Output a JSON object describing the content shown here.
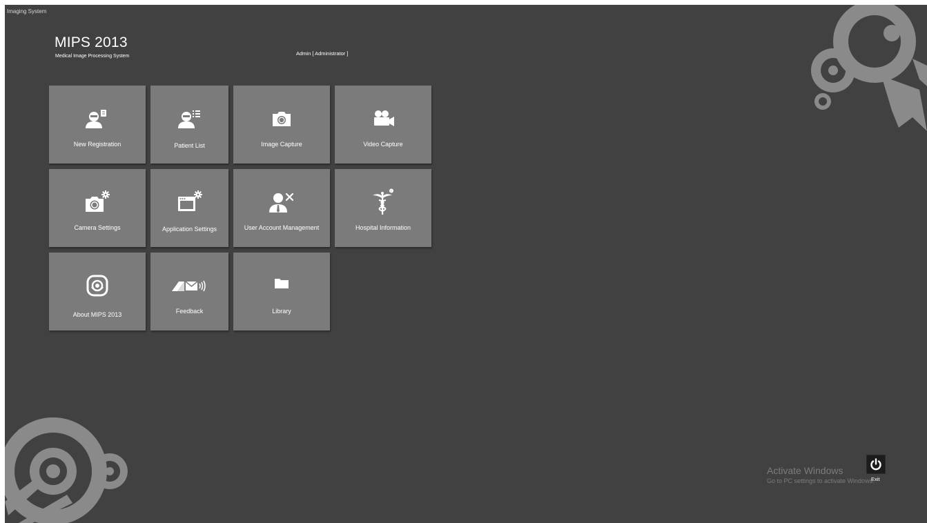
{
  "window": {
    "title": "Imaging System"
  },
  "header": {
    "app_name": "MIPS 2013",
    "app_subtitle": "Medical Image Processing System",
    "user": "Admin [ Administrator ]"
  },
  "tiles": [
    {
      "label": "New Registration",
      "icon": "user-add-icon"
    },
    {
      "label": "Patient List",
      "icon": "user-list-icon"
    },
    {
      "label": "Image Capture",
      "icon": "camera-icon"
    },
    {
      "label": "Video Capture",
      "icon": "video-camera-icon"
    },
    {
      "label": "Camera Settings",
      "icon": "camera-settings-icon"
    },
    {
      "label": "Application Settings",
      "icon": "window-settings-icon"
    },
    {
      "label": "User Account Management",
      "icon": "user-tools-icon"
    },
    {
      "label": "Hospital Information",
      "icon": "caduceus-icon"
    },
    {
      "label": "About MIPS 2013",
      "icon": "mips-logo-icon"
    },
    {
      "label": "Feedback",
      "icon": "feedback-mail-icon"
    },
    {
      "label": "Library",
      "icon": "folder-icon"
    }
  ],
  "footer": {
    "activate_title": "Activate Windows",
    "activate_sub": "Go to PC settings to activate Windows.",
    "exit_label": "Exit",
    "exit_icon": "power-icon"
  },
  "colors": {
    "background": "#414141",
    "tile": "#7b7b7b",
    "text": "#ffffff",
    "decor": "#8a8a8a"
  }
}
